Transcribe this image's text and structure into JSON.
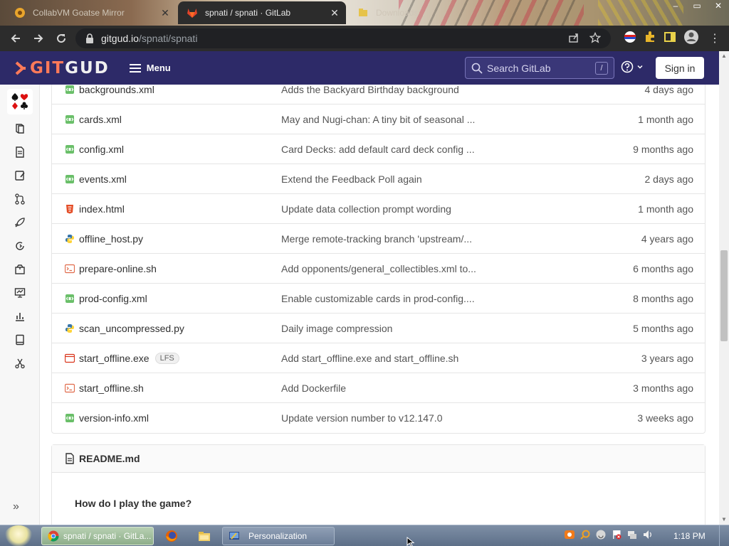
{
  "browser": {
    "tabs": [
      {
        "title": "CollabVM Goatse Mirror",
        "active": false
      },
      {
        "title": "spnati / spnati · GitLab",
        "active": true
      },
      {
        "title": "Downloads",
        "active": false
      }
    ],
    "url_host": "gitgud.io",
    "url_path": "/spnati/spnati"
  },
  "header": {
    "logo_prefix": "GIT",
    "logo_suffix": "GUD",
    "menu_label": "Menu",
    "search_placeholder": "Search GitLab",
    "search_shortcut": "/",
    "signin_label": "Sign in"
  },
  "files": [
    {
      "name": "backgrounds.xml",
      "type": "xml",
      "commit": "Adds the Backyard Birthday background",
      "date": "4 days ago"
    },
    {
      "name": "cards.xml",
      "type": "xml",
      "commit": "May and Nugi-chan: A tiny bit of seasonal ...",
      "date": "1 month ago"
    },
    {
      "name": "config.xml",
      "type": "xml",
      "commit": "Card Decks: add default card deck config ...",
      "date": "9 months ago"
    },
    {
      "name": "events.xml",
      "type": "xml",
      "commit": "Extend the Feedback Poll again",
      "date": "2 days ago"
    },
    {
      "name": "index.html",
      "type": "html",
      "commit": "Update data collection prompt wording",
      "date": "1 month ago"
    },
    {
      "name": "offline_host.py",
      "type": "py",
      "commit": "Merge remote-tracking branch 'upstream/...",
      "date": "4 years ago"
    },
    {
      "name": "prepare-online.sh",
      "type": "sh",
      "commit": "Add opponents/general_collectibles.xml to...",
      "date": "6 months ago"
    },
    {
      "name": "prod-config.xml",
      "type": "xml",
      "commit": "Enable customizable cards in prod-config....",
      "date": "8 months ago"
    },
    {
      "name": "scan_uncompressed.py",
      "type": "py",
      "commit": "Daily image compression",
      "date": "5 months ago"
    },
    {
      "name": "start_offline.exe",
      "type": "exe",
      "lfs": "LFS",
      "commit": "Add start_offline.exe and start_offline.sh",
      "date": "3 years ago"
    },
    {
      "name": "start_offline.sh",
      "type": "sh",
      "commit": "Add Dockerfile",
      "date": "3 months ago"
    },
    {
      "name": "version-info.xml",
      "type": "xml",
      "commit": "Update version number to v12.147.0",
      "date": "3 weeks ago"
    }
  ],
  "readme": {
    "filename": "README.md",
    "first_heading": "How do I play the game?"
  },
  "taskbar": {
    "chrome_task": "spnati / spnati · GitLa...",
    "personalization_task": "Personalization",
    "clock": "1:18 PM"
  },
  "colors": {
    "gitlab_header": "#2d2a68",
    "logo_accent": "#ff7a59",
    "browser_dark": "#2c2c2c"
  }
}
